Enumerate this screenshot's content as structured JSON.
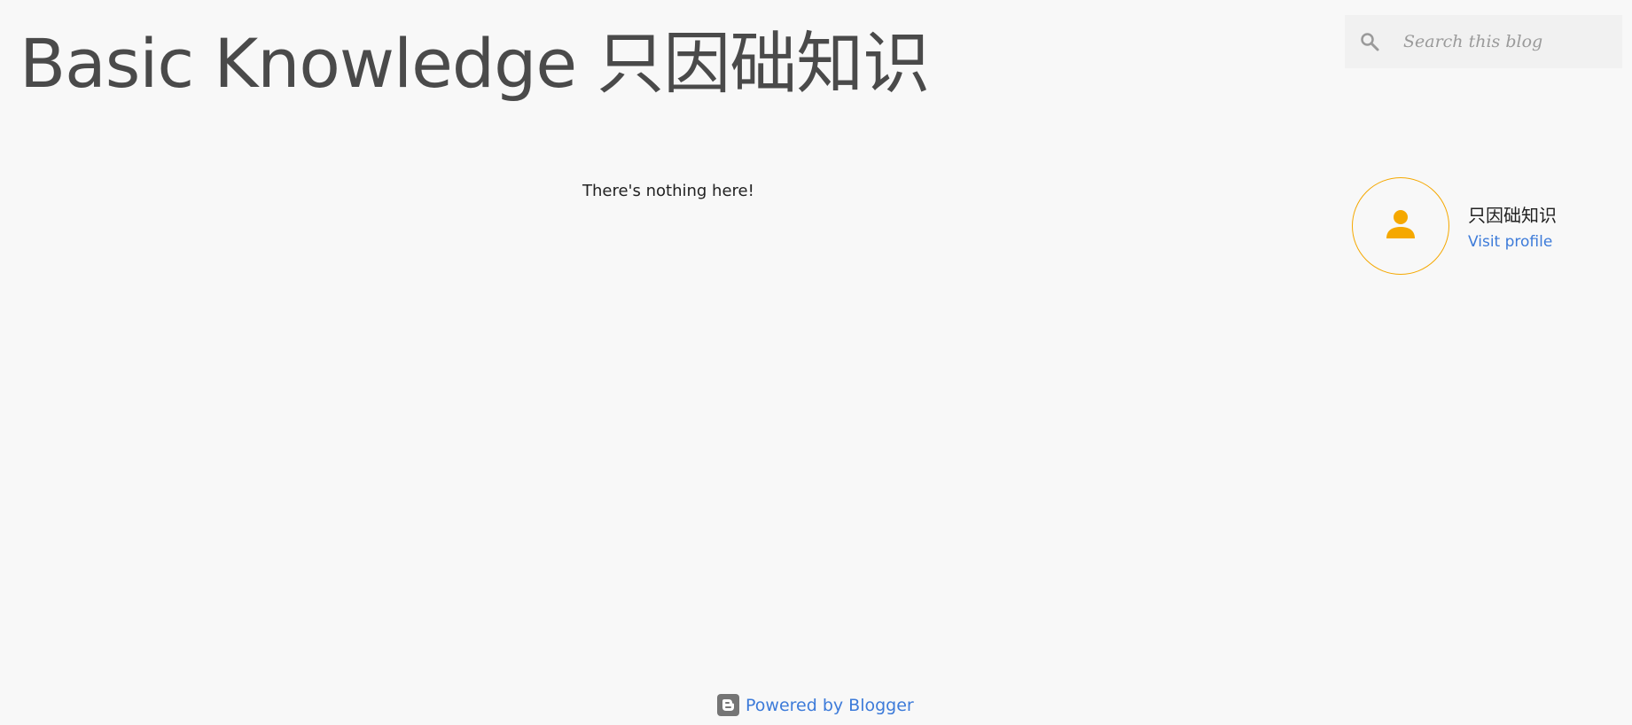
{
  "header": {
    "blog_title": "Basic Knowledge 只因础知识"
  },
  "search": {
    "placeholder": "Search this blog",
    "icon": "search-icon"
  },
  "main": {
    "empty_message": "There's nothing here!"
  },
  "profile": {
    "name": "只因础知识",
    "visit_link": "Visit profile",
    "avatar_icon": "person-icon"
  },
  "footer": {
    "powered_by": "Powered by Blogger",
    "icon": "blogger-icon"
  },
  "colors": {
    "background": "#f8f8f8",
    "title": "#4a4a4a",
    "accent": "#f5a800",
    "link": "#3d7bd9"
  }
}
